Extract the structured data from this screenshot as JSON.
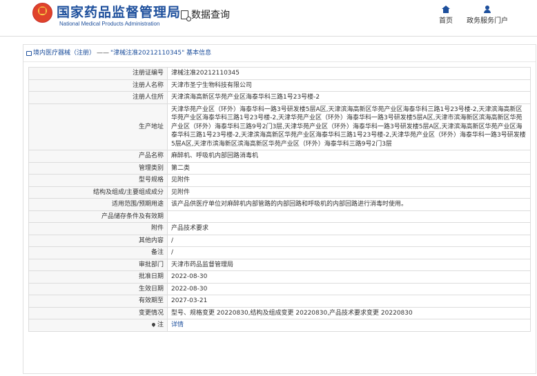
{
  "header": {
    "logo_cn": "国家药品监督管理局",
    "logo_en": "National Medical Products Administration",
    "query_title": "数据查询",
    "nav": [
      {
        "label": "首页",
        "icon": "home-icon"
      },
      {
        "label": "政务服务门户",
        "icon": "user-icon"
      }
    ]
  },
  "breadcrumb": {
    "link": "境内医疗器械（注册）",
    "separator": "——",
    "current": "\"津械注准20212110345\" 基本信息"
  },
  "details": [
    {
      "label": "注册证编号",
      "value": "津械注准20212110345"
    },
    {
      "label": "注册人名称",
      "value": "天津市圣宁生物科技有限公司"
    },
    {
      "label": "注册人住所",
      "value": "天津滨海高新区华苑产业区海泰华科三路1号23号楼-2"
    },
    {
      "label": "生产地址",
      "value": "天津华苑产业区（环外）海泰华科一路3号研发楼5层A区,天津滨海高新区华苑产业区海泰华科三路1号23号楼-2,天津滨海高新区华苑产业区海泰华科三路1号23号楼-2,天津华苑产业区（环外）海泰华科一路3号研发楼5层A区,天津市滨海新区滨海高新区华苑产业区（环外）海泰华科三路9号2门3层,天津华苑产业区（环外）海泰华科一路3号研发楼5层A区,天津滨海高新区华苑产业区海泰华科三路1号23号楼-2,天津滨海高新区华苑产业区海泰华科三路1号23号楼-2,天津华苑产业区（环外）海泰华科一路3号研发楼5层A区,天津市滨海新区滨海高新区华苑产业区（环外）海泰华科三路9号2门3层"
    },
    {
      "label": "产品名称",
      "value": "麻醉机、呼吸机内部回路消毒机"
    },
    {
      "label": "管理类别",
      "value": "第二类"
    },
    {
      "label": "型号规格",
      "value": "见附件"
    },
    {
      "label": "结构及组成/主要组成成分",
      "value": "见附件"
    },
    {
      "label": "适用范围/预期用途",
      "value": "该产品供医疗单位对麻醉机内部管路的内部回路和呼吸机的内部回路进行消毒时使用。"
    },
    {
      "label": "产品储存条件及有效期",
      "value": ""
    },
    {
      "label": "附件",
      "value": "产品技术要求"
    },
    {
      "label": "其他内容",
      "value": "/"
    },
    {
      "label": "备注",
      "value": "/"
    },
    {
      "label": "审批部门",
      "value": "天津市药品监督管理局"
    },
    {
      "label": "批准日期",
      "value": "2022-08-30"
    },
    {
      "label": "生效日期",
      "value": "2022-08-30"
    },
    {
      "label": "有效期至",
      "value": "2027-03-21"
    },
    {
      "label": "变更情况",
      "value": "型号、规格变更 20220830,结构及组成变更 20220830,产品技术要求变更 20220830"
    }
  ],
  "note": {
    "label": "注",
    "value": "详情",
    "icon": "pin-icon"
  },
  "colors": {
    "brand": "#1d4f9c",
    "label_bg": "#f7f7f7",
    "border": "#dcdcdc"
  }
}
